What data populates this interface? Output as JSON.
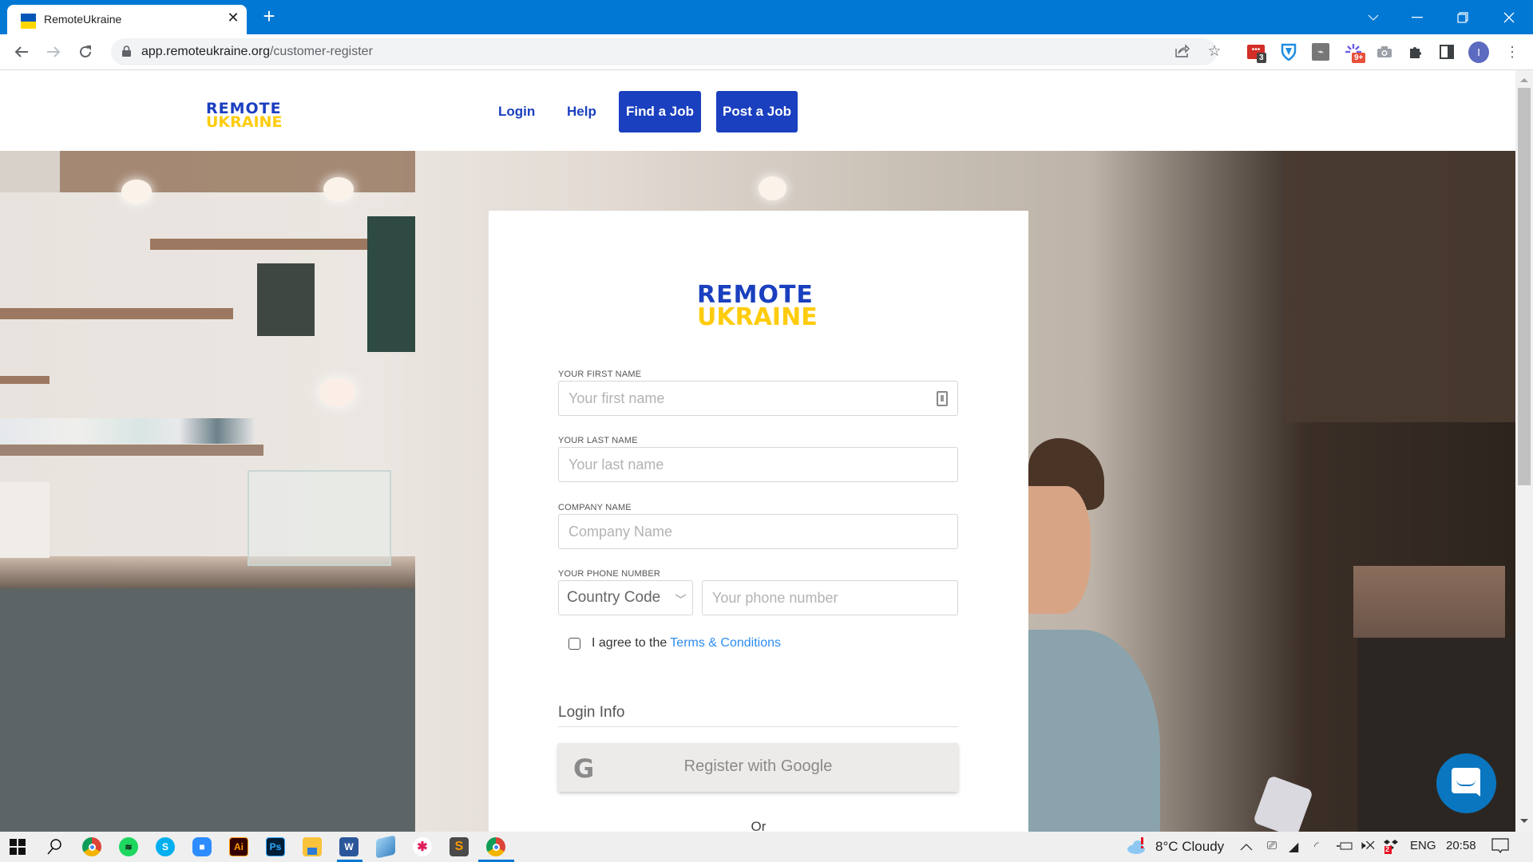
{
  "browser": {
    "tab_title": "RemoteUkraine",
    "tab_close": "✕",
    "new_tab": "+",
    "url_host": "app.remoteukraine.org",
    "url_path": "/customer-register",
    "window_controls": {
      "tab_search": "⌄",
      "minimize": "—",
      "restore": "❐",
      "close": "✕"
    },
    "nav": {
      "back": "←",
      "forward": "→",
      "reload": "↻"
    },
    "extensions": [
      {
        "name": "lastpass",
        "badge": "3"
      },
      {
        "name": "zenmate-vpn",
        "badge": ""
      },
      {
        "name": "hubspot",
        "badge": ""
      },
      {
        "name": "clickup",
        "badge": "9+"
      },
      {
        "name": "screenshot",
        "badge": ""
      },
      {
        "name": "extensions-puzzle",
        "badge": ""
      },
      {
        "name": "side-panel",
        "badge": ""
      }
    ],
    "profile_initial": "I",
    "menu": "⋮"
  },
  "site_header": {
    "logo_line1": "REMOTE",
    "logo_line2": "UKRAINE",
    "nav": {
      "login": "Login",
      "help": "Help",
      "find_job": "Find a Job",
      "post_job": "Post a Job"
    }
  },
  "form": {
    "logo_line1": "REMOTE",
    "logo_line2": "UKRAINE",
    "first_name": {
      "label": "YOUR FIRST NAME",
      "placeholder": "Your first name",
      "value": ""
    },
    "last_name": {
      "label": "YOUR LAST NAME",
      "placeholder": "Your last name",
      "value": ""
    },
    "company": {
      "label": "COMPANY NAME",
      "placeholder": "Company Name",
      "value": ""
    },
    "phone": {
      "label": "YOUR PHONE NUMBER",
      "country_code_selected": "Country Code",
      "placeholder": "Your phone number",
      "value": ""
    },
    "agree": {
      "text": "I agree to the",
      "link": "Terms & Conditions",
      "checked": false
    },
    "login_info_heading": "Login Info",
    "google_button": "Register with Google",
    "or_text": "Or"
  },
  "colors": {
    "brand_blue": "#1a3fbf",
    "brand_yellow": "#ffcc0d",
    "link_blue": "#2d8cf0",
    "chrome_blue": "#0078d4",
    "chat_blue": "#0a76c0"
  },
  "taskbar": {
    "apps": [
      "windows-start",
      "search",
      "chrome",
      "spotify",
      "skype",
      "zoom",
      "illustrator",
      "photoshop",
      "file-explorer",
      "word",
      "notepad",
      "slack",
      "sublime-text",
      "chrome-profile"
    ],
    "weather": "8°C  Cloudy",
    "language": "ENG",
    "time": "20:58",
    "dropbox_badge": "2"
  }
}
